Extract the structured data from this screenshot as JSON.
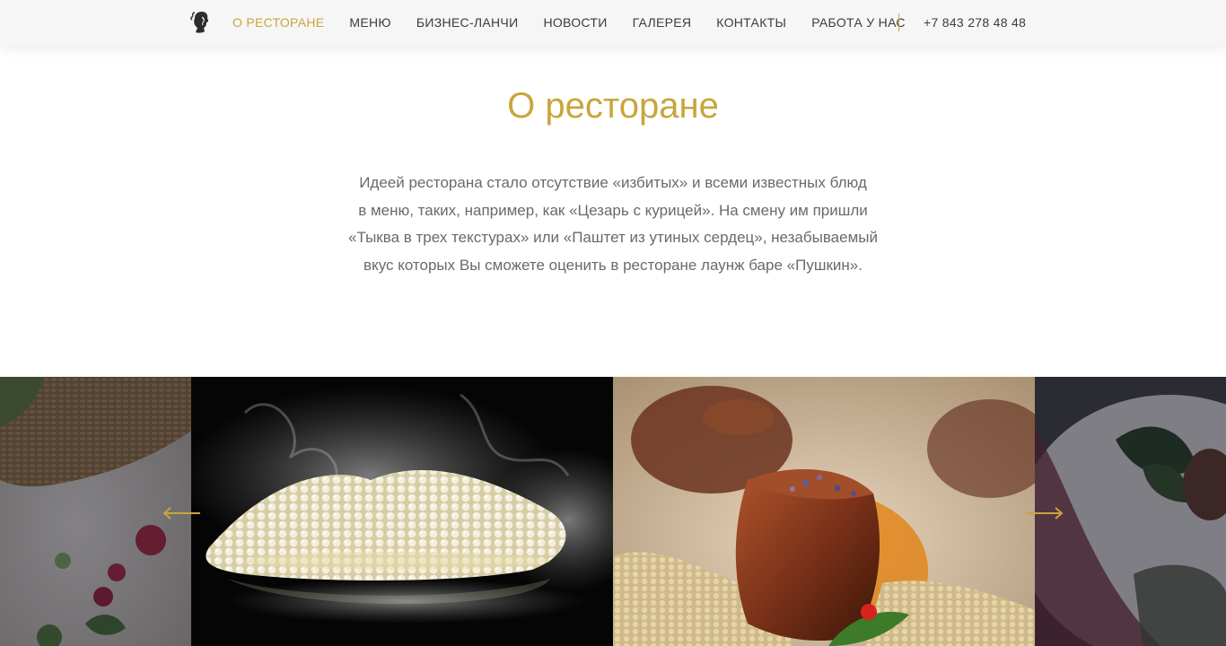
{
  "nav": {
    "logo_name": "pushkin-portrait-logo",
    "items": [
      {
        "label": "О РЕСТОРАНЕ",
        "active": true
      },
      {
        "label": "МЕНЮ",
        "active": false
      },
      {
        "label": "БИЗНЕС-ЛАНЧИ",
        "active": false
      },
      {
        "label": "НОВОСТИ",
        "active": false
      },
      {
        "label": "ГАЛЕРЕЯ",
        "active": false
      },
      {
        "label": "КОНТАКТЫ",
        "active": false
      },
      {
        "label": "РАБОТА У НАС",
        "active": false
      }
    ],
    "phone": "+7 843 278 48 48"
  },
  "about": {
    "title": "О ресторане",
    "lines": [
      "Идеей ресторана стало отсутствие «избитых» и всеми известных блюд",
      "в меню, таких, например, как «Цезарь с курицей». На смену им пришли",
      "«Тыква в трех текстурах» или «Паштет из утиных сердец», незабываемый",
      "вкус которых Вы сможете оценить в ресторане лаунж баре «Пушкин»."
    ]
  },
  "gallery": {
    "prev_icon": "arrow-left-icon",
    "next_icon": "arrow-right-icon",
    "photos": [
      "grain-dish-photo",
      "smoking-pearl-dish-photo",
      "seared-meat-dish-photo",
      "plated-greens-dish-photo"
    ]
  },
  "colors": {
    "accent": "#c9a53b",
    "nav_text": "#3c3c3c",
    "body_text": "#6a6a6a",
    "nav_background": "#f6f6f6"
  }
}
